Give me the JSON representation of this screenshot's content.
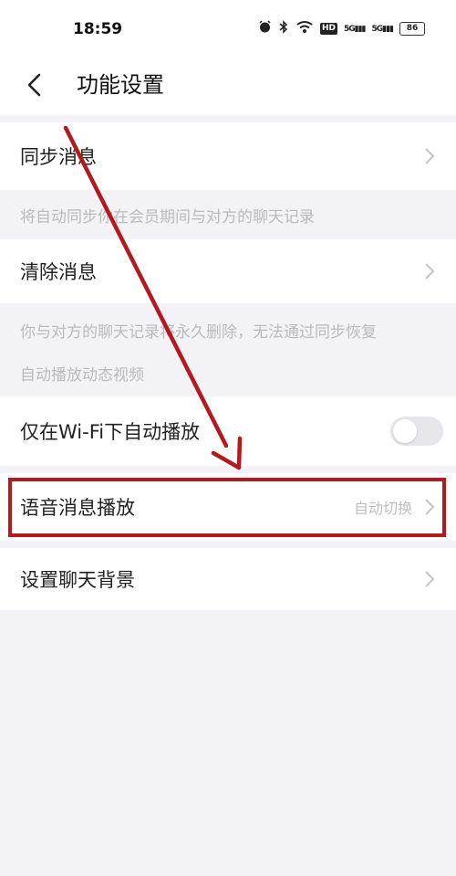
{
  "status": {
    "time": "18:59",
    "battery": "86",
    "hd": "HD",
    "net1": "5G",
    "net2": "5G"
  },
  "header": {
    "title": "功能设置"
  },
  "rows": {
    "sync": {
      "label": "同步消息"
    },
    "sync_desc": "将自动同步你在会员期间与对方的聊天记录",
    "clear": {
      "label": "清除消息"
    },
    "clear_desc": "你与对方的聊天记录将永久删除，无法通过同步恢复",
    "autoplay_section": "自动播放动态视频",
    "wifi_autoplay": {
      "label": "仅在Wi-Fi下自动播放",
      "enabled": false
    },
    "voice": {
      "label": "语音消息播放",
      "value": "自动切换"
    },
    "background": {
      "label": "设置聊天背景"
    }
  },
  "colors": {
    "accent": "#b3191d",
    "bg": "#f3f3f7"
  }
}
